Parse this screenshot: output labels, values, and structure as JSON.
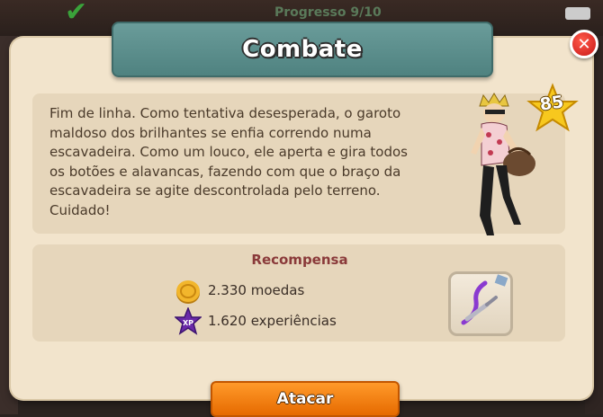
{
  "background": {
    "progress_text": "Progresso 9/10"
  },
  "dialog": {
    "title": "Combate",
    "close_symbol": "✕",
    "story": "Fim de linha. Como tentativa desesperada, o garoto maldoso dos brilhantes se enfia correndo numa escavadeira. Como um louco, ele aperta e gira todos os botões e alavancas, fazendo com que o braço da escavadeira se agite descontrolada pelo terreno. Cuidado!",
    "level": "85",
    "reward_title": "Recompensa",
    "rewards": {
      "coins": "2.330 moedas",
      "xp": "1.620 experiências",
      "xp_badge": "XP"
    },
    "attack_label": "Atacar"
  },
  "colors": {
    "title_banner": "#5a8e8c",
    "attack_button": "#f08010",
    "close_button": "#e02020",
    "reward_title": "#8a3a3a"
  },
  "icons": {
    "close": "close-icon",
    "level": "star-icon",
    "coin": "coin-icon",
    "xp": "xp-star-icon",
    "item": "purple-whip-icon"
  }
}
